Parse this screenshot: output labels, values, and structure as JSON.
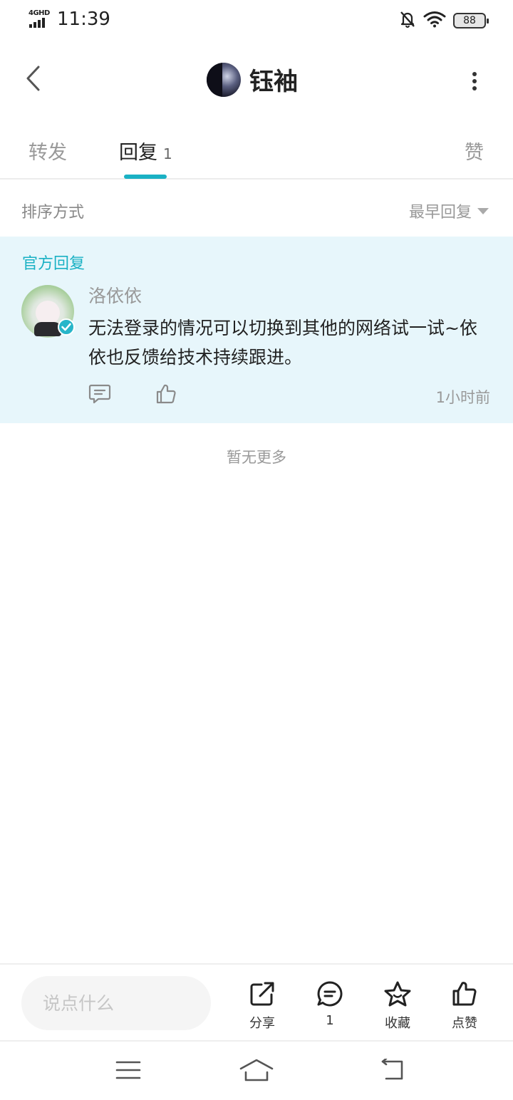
{
  "status_bar": {
    "network": "4GHD",
    "time": "11:39",
    "battery": "88"
  },
  "header": {
    "title": "钰袖"
  },
  "tabs": {
    "forward": "转发",
    "reply": "回复",
    "reply_count": "1",
    "like": "赞"
  },
  "sort": {
    "label": "排序方式",
    "value": "最早回复"
  },
  "reply": {
    "tag": "官方回复",
    "author": "洛依依",
    "text": "无法登录的情况可以切换到其他的网络试一试~依依也反馈给技术持续跟进。",
    "time": "1小时前"
  },
  "footer_note": "暂无更多",
  "bottom_bar": {
    "input_placeholder": "说点什么",
    "share_label": "分享",
    "comment_count": "1",
    "favorite_label": "收藏",
    "like_label": "点赞"
  },
  "icons": {
    "back": "chevron-left-icon",
    "more": "more-vertical-icon",
    "comment": "comment-icon",
    "like": "thumb-up-icon",
    "share": "share-icon",
    "favorite": "star-icon",
    "verified": "verified-check-icon"
  },
  "colors": {
    "accent": "#1ab1c4",
    "card_bg": "#e7f6fb",
    "muted_text": "#999999"
  }
}
